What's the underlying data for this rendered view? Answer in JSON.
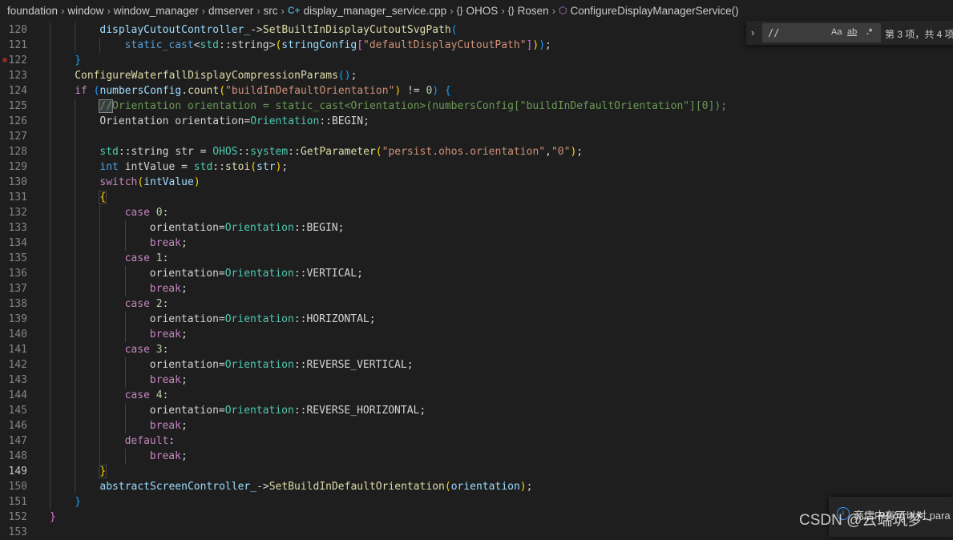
{
  "breadcrumb": {
    "items": [
      "foundation",
      "window",
      "window_manager",
      "dmserver",
      "src",
      "display_manager_service.cpp",
      "OHOS",
      "Rosen",
      "ConfigureDisplayManagerService()"
    ],
    "icons": [
      "cpp-file-icon",
      "namespace-icon",
      "namespace-icon",
      "method-icon"
    ]
  },
  "find": {
    "query": "//",
    "match_case": "Aa",
    "whole_word": "ab",
    "regex": ".*",
    "result": "第 3 项，共 4 项"
  },
  "notification": {
    "text": "商店中有可以对 para"
  },
  "watermark": "CSDN @云端筑梦~",
  "lines": [
    {
      "n": "120",
      "active": false,
      "indent": 2,
      "tokens": [
        {
          "t": "displayCutoutController_",
          "c": "t-var"
        },
        {
          "t": "->",
          "c": "t-pl"
        },
        {
          "t": "SetBuiltInDisplayCutoutSvgPath",
          "c": "t-fn"
        },
        {
          "t": "(",
          "c": "t-b3"
        }
      ]
    },
    {
      "n": "121",
      "active": false,
      "indent": 3,
      "tokens": [
        {
          "t": "static_cast",
          "c": "t-kw"
        },
        {
          "t": "<",
          "c": "t-pl"
        },
        {
          "t": "std",
          "c": "t-type"
        },
        {
          "t": "::",
          "c": "t-pl"
        },
        {
          "t": "string",
          "c": "t-pl"
        },
        {
          "t": ">",
          "c": "t-pl"
        },
        {
          "t": "(",
          "c": "t-b1"
        },
        {
          "t": "stringConfig",
          "c": "t-var"
        },
        {
          "t": "[",
          "c": "t-b2"
        },
        {
          "t": "\"defaultDisplayCutoutPath\"",
          "c": "t-str"
        },
        {
          "t": "]",
          "c": "t-b2"
        },
        {
          "t": ")",
          "c": "t-b1"
        },
        {
          "t": ")",
          "c": "t-b3"
        },
        {
          "t": ";",
          "c": "t-pl"
        }
      ]
    },
    {
      "n": "122",
      "active": false,
      "bp": true,
      "indent": 1,
      "tokens": [
        {
          "t": "}",
          "c": "t-b3"
        }
      ]
    },
    {
      "n": "123",
      "active": false,
      "indent": 1,
      "tokens": [
        {
          "t": "ConfigureWaterfallDisplayCompressionParams",
          "c": "t-fn"
        },
        {
          "t": "()",
          "c": "t-b3"
        },
        {
          "t": ";",
          "c": "t-pl"
        }
      ]
    },
    {
      "n": "124",
      "active": false,
      "indent": 1,
      "tokens": [
        {
          "t": "if",
          "c": "t-ctl"
        },
        {
          "t": " ",
          "c": "t-pl"
        },
        {
          "t": "(",
          "c": "t-b3"
        },
        {
          "t": "numbersConfig",
          "c": "t-var"
        },
        {
          "t": ".",
          "c": "t-pl"
        },
        {
          "t": "count",
          "c": "t-fn"
        },
        {
          "t": "(",
          "c": "t-b1"
        },
        {
          "t": "\"buildInDefaultOrientation\"",
          "c": "t-str"
        },
        {
          "t": ")",
          "c": "t-b1"
        },
        {
          "t": " != ",
          "c": "t-pl"
        },
        {
          "t": "0",
          "c": "t-num"
        },
        {
          "t": ")",
          "c": "t-b3"
        },
        {
          "t": " ",
          "c": "t-pl"
        },
        {
          "t": "{",
          "c": "t-b3"
        }
      ]
    },
    {
      "n": "125",
      "active": false,
      "indent": 2,
      "tokens": [
        {
          "t": "//",
          "c": "t-cmt bm"
        },
        {
          "t": "Orientation orientation = static_cast<Orientation>(numbersConfig[\"buildInDefaultOrientation\"][0]);",
          "c": "t-cmt"
        }
      ]
    },
    {
      "n": "126",
      "active": false,
      "indent": 2,
      "tokens": [
        {
          "t": "Orientation orientation=",
          "c": "t-pl"
        },
        {
          "t": "Orientation",
          "c": "t-type"
        },
        {
          "t": "::BEGIN;",
          "c": "t-pl"
        }
      ]
    },
    {
      "n": "127",
      "active": false,
      "indent": 0,
      "tokens": []
    },
    {
      "n": "128",
      "active": false,
      "indent": 2,
      "tokens": [
        {
          "t": "std",
          "c": "t-type"
        },
        {
          "t": "::",
          "c": "t-pl"
        },
        {
          "t": "string str = ",
          "c": "t-pl"
        },
        {
          "t": "OHOS",
          "c": "t-type"
        },
        {
          "t": "::",
          "c": "t-pl"
        },
        {
          "t": "system",
          "c": "t-type"
        },
        {
          "t": "::",
          "c": "t-pl"
        },
        {
          "t": "GetParameter",
          "c": "t-fn"
        },
        {
          "t": "(",
          "c": "t-b1"
        },
        {
          "t": "\"persist.ohos.orientation\"",
          "c": "t-str"
        },
        {
          "t": ",",
          "c": "t-pl"
        },
        {
          "t": "\"0\"",
          "c": "t-str"
        },
        {
          "t": ")",
          "c": "t-b1"
        },
        {
          "t": ";",
          "c": "t-pl"
        }
      ]
    },
    {
      "n": "129",
      "active": false,
      "indent": 2,
      "tokens": [
        {
          "t": "int",
          "c": "t-kw"
        },
        {
          "t": " intValue = ",
          "c": "t-pl"
        },
        {
          "t": "std",
          "c": "t-type"
        },
        {
          "t": "::",
          "c": "t-pl"
        },
        {
          "t": "stoi",
          "c": "t-fn"
        },
        {
          "t": "(",
          "c": "t-b1"
        },
        {
          "t": "str",
          "c": "t-var"
        },
        {
          "t": ")",
          "c": "t-b1"
        },
        {
          "t": ";",
          "c": "t-pl"
        }
      ]
    },
    {
      "n": "130",
      "active": false,
      "indent": 2,
      "tokens": [
        {
          "t": "switch",
          "c": "t-ctl"
        },
        {
          "t": "(",
          "c": "t-b1"
        },
        {
          "t": "intValue",
          "c": "t-var"
        },
        {
          "t": ")",
          "c": "t-b1"
        }
      ]
    },
    {
      "n": "131",
      "active": false,
      "indent": 2,
      "tokens": [
        {
          "t": "{",
          "c": "t-b1 cur"
        }
      ]
    },
    {
      "n": "132",
      "active": false,
      "indent": 3,
      "tokens": [
        {
          "t": "case",
          "c": "t-ctl"
        },
        {
          "t": " ",
          "c": "t-pl"
        },
        {
          "t": "0",
          "c": "t-num"
        },
        {
          "t": ":",
          "c": "t-pl"
        }
      ]
    },
    {
      "n": "133",
      "active": false,
      "indent": 4,
      "tokens": [
        {
          "t": "orientation=",
          "c": "t-pl"
        },
        {
          "t": "Orientation",
          "c": "t-type"
        },
        {
          "t": "::BEGIN;",
          "c": "t-pl"
        }
      ]
    },
    {
      "n": "134",
      "active": false,
      "indent": 4,
      "tokens": [
        {
          "t": "break",
          "c": "t-ctl"
        },
        {
          "t": ";",
          "c": "t-pl"
        }
      ]
    },
    {
      "n": "135",
      "active": false,
      "indent": 3,
      "tokens": [
        {
          "t": "case",
          "c": "t-ctl"
        },
        {
          "t": " ",
          "c": "t-pl"
        },
        {
          "t": "1",
          "c": "t-num"
        },
        {
          "t": ":",
          "c": "t-pl"
        }
      ]
    },
    {
      "n": "136",
      "active": false,
      "indent": 4,
      "tokens": [
        {
          "t": "orientation=",
          "c": "t-pl"
        },
        {
          "t": "Orientation",
          "c": "t-type"
        },
        {
          "t": "::VERTICAL;",
          "c": "t-pl"
        }
      ]
    },
    {
      "n": "137",
      "active": false,
      "indent": 4,
      "tokens": [
        {
          "t": "break",
          "c": "t-ctl"
        },
        {
          "t": ";",
          "c": "t-pl"
        }
      ]
    },
    {
      "n": "138",
      "active": false,
      "indent": 3,
      "tokens": [
        {
          "t": "case",
          "c": "t-ctl"
        },
        {
          "t": " ",
          "c": "t-pl"
        },
        {
          "t": "2",
          "c": "t-num"
        },
        {
          "t": ":",
          "c": "t-pl"
        }
      ]
    },
    {
      "n": "139",
      "active": false,
      "indent": 4,
      "tokens": [
        {
          "t": "orientation=",
          "c": "t-pl"
        },
        {
          "t": "Orientation",
          "c": "t-type"
        },
        {
          "t": "::HORIZONTAL;",
          "c": "t-pl"
        }
      ]
    },
    {
      "n": "140",
      "active": false,
      "indent": 4,
      "tokens": [
        {
          "t": "break",
          "c": "t-ctl"
        },
        {
          "t": ";",
          "c": "t-pl"
        }
      ]
    },
    {
      "n": "141",
      "active": false,
      "indent": 3,
      "tokens": [
        {
          "t": "case",
          "c": "t-ctl"
        },
        {
          "t": " ",
          "c": "t-pl"
        },
        {
          "t": "3",
          "c": "t-num"
        },
        {
          "t": ":",
          "c": "t-pl"
        }
      ]
    },
    {
      "n": "142",
      "active": false,
      "indent": 4,
      "tokens": [
        {
          "t": "orientation=",
          "c": "t-pl"
        },
        {
          "t": "Orientation",
          "c": "t-type"
        },
        {
          "t": "::REVERSE_VERTICAL;",
          "c": "t-pl"
        }
      ]
    },
    {
      "n": "143",
      "active": false,
      "indent": 4,
      "tokens": [
        {
          "t": "break",
          "c": "t-ctl"
        },
        {
          "t": ";",
          "c": "t-pl"
        }
      ]
    },
    {
      "n": "144",
      "active": false,
      "indent": 3,
      "tokens": [
        {
          "t": "case",
          "c": "t-ctl"
        },
        {
          "t": " ",
          "c": "t-pl"
        },
        {
          "t": "4",
          "c": "t-num"
        },
        {
          "t": ":",
          "c": "t-pl"
        }
      ]
    },
    {
      "n": "145",
      "active": false,
      "indent": 4,
      "tokens": [
        {
          "t": "orientation=",
          "c": "t-pl"
        },
        {
          "t": "Orientation",
          "c": "t-type"
        },
        {
          "t": "::REVERSE_HORIZONTAL;",
          "c": "t-pl"
        }
      ]
    },
    {
      "n": "146",
      "active": false,
      "indent": 4,
      "tokens": [
        {
          "t": "break",
          "c": "t-ctl"
        },
        {
          "t": ";",
          "c": "t-pl"
        }
      ]
    },
    {
      "n": "147",
      "active": false,
      "indent": 3,
      "tokens": [
        {
          "t": "default",
          "c": "t-ctl"
        },
        {
          "t": ":",
          "c": "t-pl"
        }
      ]
    },
    {
      "n": "148",
      "active": false,
      "indent": 4,
      "tokens": [
        {
          "t": "break",
          "c": "t-ctl"
        },
        {
          "t": ";",
          "c": "t-pl"
        }
      ]
    },
    {
      "n": "149",
      "active": true,
      "indent": 2,
      "tokens": [
        {
          "t": "}",
          "c": "t-b1 cur"
        }
      ]
    },
    {
      "n": "150",
      "active": false,
      "indent": 2,
      "tokens": [
        {
          "t": "abstractScreenController_",
          "c": "t-var"
        },
        {
          "t": "->",
          "c": "t-pl"
        },
        {
          "t": "SetBuildInDefaultOrientation",
          "c": "t-fn"
        },
        {
          "t": "(",
          "c": "t-b1"
        },
        {
          "t": "orientation",
          "c": "t-var"
        },
        {
          "t": ")",
          "c": "t-b1"
        },
        {
          "t": ";",
          "c": "t-pl"
        }
      ]
    },
    {
      "n": "151",
      "active": false,
      "indent": 1,
      "tokens": [
        {
          "t": "}",
          "c": "t-b3"
        }
      ]
    },
    {
      "n": "152",
      "active": false,
      "indent": 0,
      "tokens": [
        {
          "t": "}",
          "c": "t-b2"
        }
      ]
    },
    {
      "n": "153",
      "active": false,
      "indent": 0,
      "tokens": []
    }
  ]
}
